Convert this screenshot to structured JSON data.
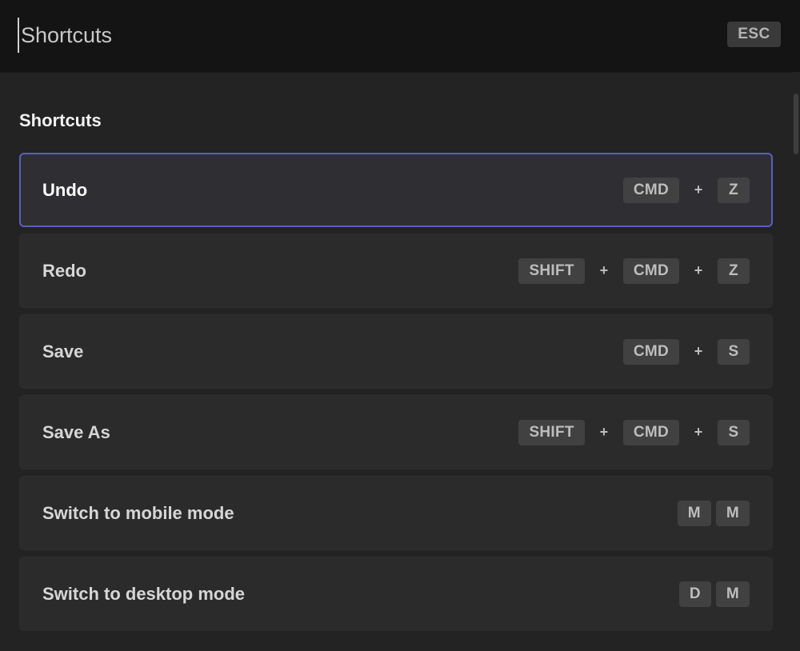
{
  "search": {
    "placeholder": "Shortcuts",
    "esc_label": "ESC"
  },
  "section": {
    "title": "Shortcuts"
  },
  "shortcuts": [
    {
      "label": "Undo",
      "active": true,
      "combo": "chord",
      "keys": [
        "CMD",
        "Z"
      ]
    },
    {
      "label": "Redo",
      "active": false,
      "combo": "chord",
      "keys": [
        "SHIFT",
        "CMD",
        "Z"
      ]
    },
    {
      "label": "Save",
      "active": false,
      "combo": "chord",
      "keys": [
        "CMD",
        "S"
      ]
    },
    {
      "label": "Save As",
      "active": false,
      "combo": "chord",
      "keys": [
        "SHIFT",
        "CMD",
        "S"
      ]
    },
    {
      "label": "Switch to mobile mode",
      "active": false,
      "combo": "sequence",
      "keys": [
        "M",
        "M"
      ]
    },
    {
      "label": "Switch to desktop mode",
      "active": false,
      "combo": "sequence",
      "keys": [
        "D",
        "M"
      ]
    }
  ],
  "plus_symbol": "+",
  "colors": {
    "background": "#232323",
    "header": "#141414",
    "row": "#2b2b2b",
    "active_border": "#5a5fbf",
    "key": "#414141"
  }
}
